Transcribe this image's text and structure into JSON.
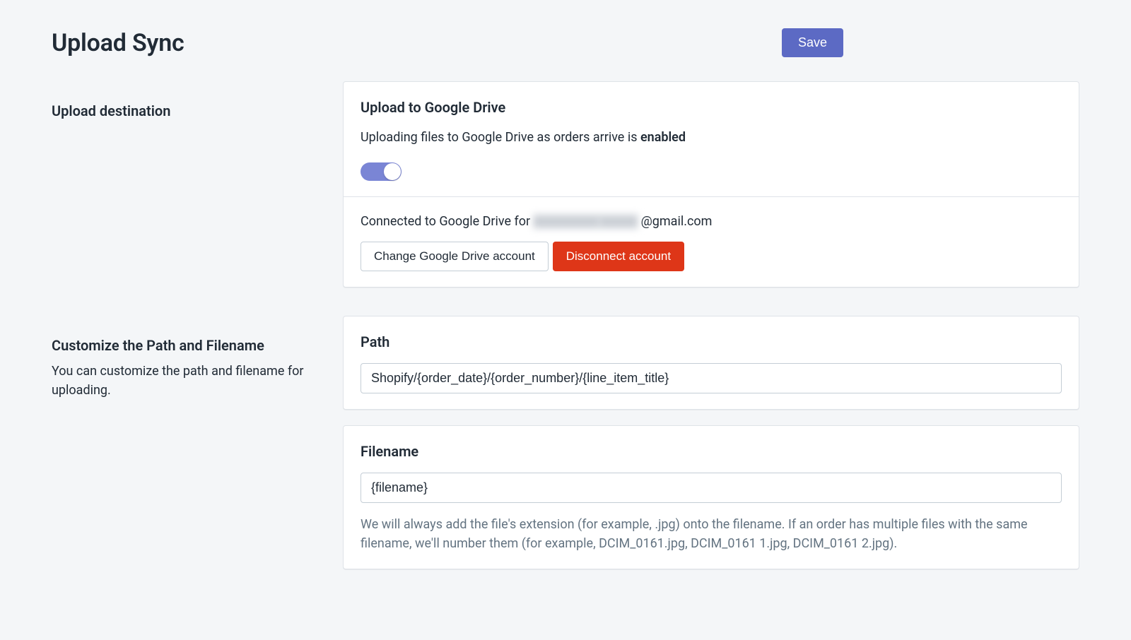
{
  "header": {
    "title": "Upload Sync",
    "save_label": "Save"
  },
  "section_upload_destination": {
    "heading": "Upload destination",
    "card": {
      "title": "Upload to Google Drive",
      "status_text_prefix": "Uploading files to Google Drive as orders arrive is ",
      "status_text_strong": "enabled",
      "connected_prefix": "Connected to Google Drive for ",
      "connected_blurred": "xxxxxxxxx xxxxx",
      "connected_suffix": "@gmail.com",
      "change_account_label": "Change Google Drive account",
      "disconnect_label": "Disconnect account"
    }
  },
  "section_customize": {
    "heading": "Customize the Path and Filename",
    "description": "You can customize the path and filename for uploading.",
    "path_card": {
      "title": "Path",
      "value": "Shopify/{order_date}/{order_number}/{line_item_title}"
    },
    "filename_card": {
      "title": "Filename",
      "value": "{filename}",
      "help": "We will always add the file's extension (for example, .jpg) onto the filename. If an order has multiple files with the same filename, we'll number them (for example, DCIM_0161.jpg, DCIM_0161 1.jpg, DCIM_0161 2.jpg)."
    }
  }
}
